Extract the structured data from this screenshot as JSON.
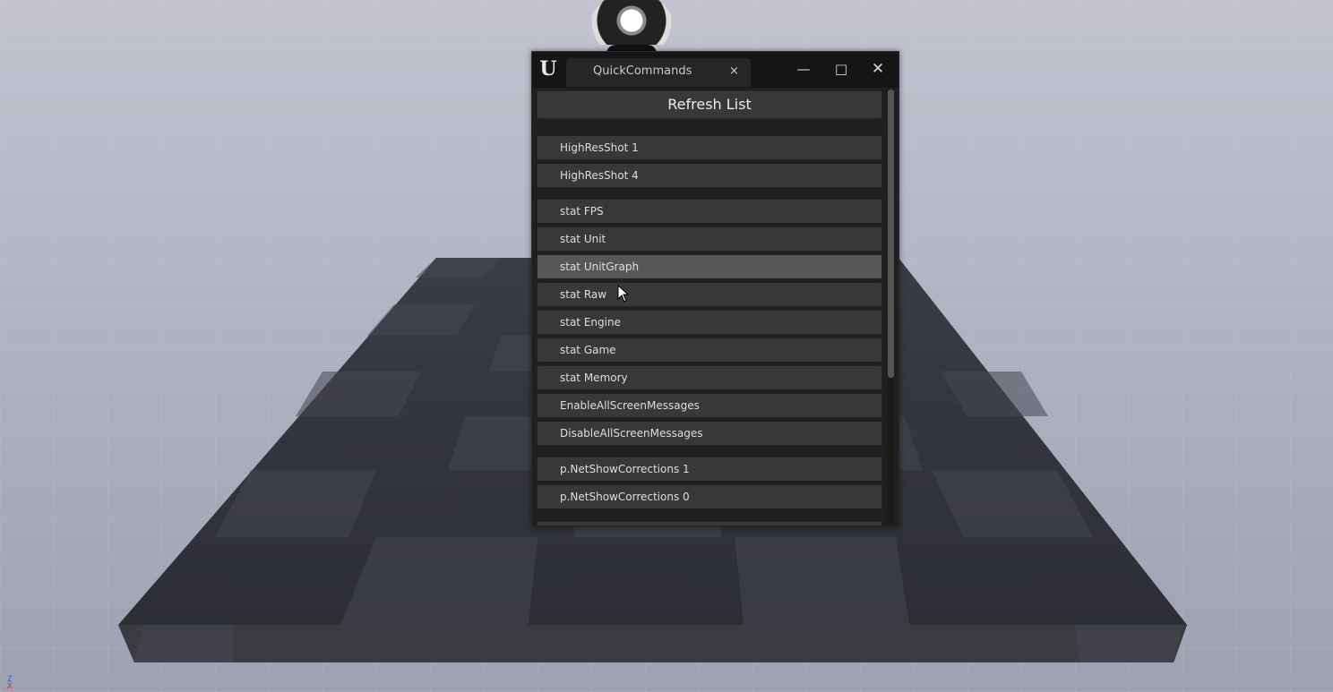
{
  "window": {
    "tab_title": "QuickCommands",
    "tab_close": "×",
    "minimize": "—",
    "maximize": "□",
    "close": "✕",
    "logo": "U"
  },
  "refresh_label": "Refresh List",
  "groups": [
    [
      "HighResShot 1",
      "HighResShot 4"
    ],
    [
      "stat FPS",
      "stat Unit",
      "stat UnitGraph",
      "stat Raw",
      "stat Engine",
      "stat Game",
      "stat Memory",
      "EnableAllScreenMessages",
      "DisableAllScreenMessages"
    ],
    [
      "p.NetShowCorrections 1",
      "p.NetShowCorrections 0"
    ]
  ],
  "hovered_command": "stat UnitGraph",
  "axis": {
    "z": "Z",
    "x": "X"
  },
  "icons": [
    "unreal-logo-icon",
    "tab-close-icon",
    "minimize-icon",
    "maximize-icon",
    "close-icon",
    "mouse-cursor-icon"
  ]
}
